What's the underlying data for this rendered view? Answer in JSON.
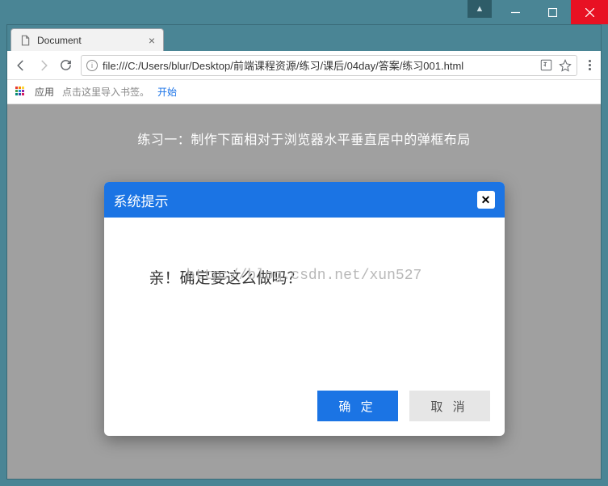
{
  "window": {
    "profile_glyph": "▲"
  },
  "browser": {
    "tab_title": "Document",
    "url": "file:///C:/Users/blur/Desktop/前端课程资源/练习/课后/04day/答案/练习001.html",
    "apps_label": "应用",
    "bookmarks_hint": "点击这里导入书签。",
    "bookmarks_start": "开始"
  },
  "page": {
    "heading": "练习一：制作下面相对于浏览器水平垂直居中的弹框布局",
    "watermark": "http://blog.csdn.net/xun527"
  },
  "dialog": {
    "title": "系统提示",
    "message": "亲！确定要这么做吗？",
    "confirm": "确 定",
    "cancel": "取 消"
  }
}
